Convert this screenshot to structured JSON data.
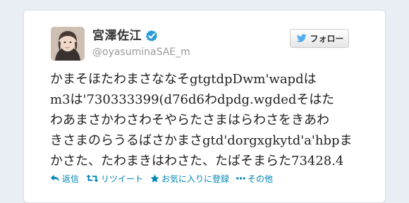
{
  "tweet": {
    "user": {
      "display_name": "宮澤佐江",
      "handle": "@oyasuminaSAE_m",
      "verified": true
    },
    "follow_button": {
      "label": "フォロー",
      "icon": "twitter-bird-icon"
    },
    "text_lines": [
      "かまそほたわまさななそgtgtdpDwm'wapdは",
      "m3は'730333399(d76d6わdpdg.wgdedそはた",
      "わあまさかわさわそやらたさまはらわさをきあわ",
      "きさまのらうるばさかまさgtd'dorgxgkytd'a'hbpま",
      "かさた、たわまきはわさた、たばそまらた73428.4"
    ],
    "actions": [
      {
        "icon": "reply-icon",
        "label": "返信"
      },
      {
        "icon": "retweet-icon",
        "label": "リツイート"
      },
      {
        "icon": "star-icon",
        "label": "お気に入りに登録"
      },
      {
        "icon": "more-icon",
        "label": "その他"
      }
    ]
  },
  "colors": {
    "link": "#0084b4",
    "name": "#333333",
    "handle": "#999999",
    "verified": "#2b9bd7",
    "background": "#e8eef3"
  }
}
